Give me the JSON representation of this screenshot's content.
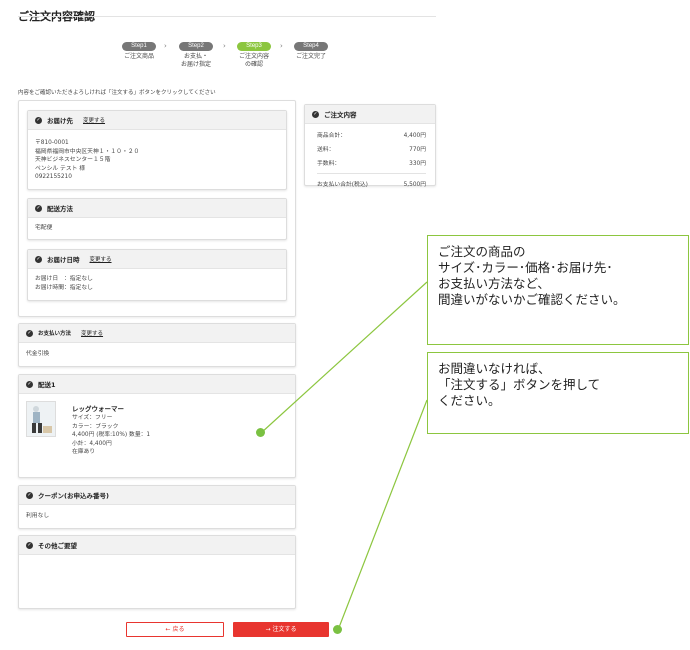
{
  "page": {
    "title": "ご注文内容確認",
    "intro": "内容をご確認いただきよろしければ「注文する」ボタンをクリックしてください"
  },
  "steps": [
    {
      "pill": "Step1",
      "label": "ご注文商品",
      "active": false
    },
    {
      "pill": "Step2",
      "label": "お支払・\nお届け指定",
      "active": false
    },
    {
      "pill": "Step3",
      "label": "ご注文内容\nの確認",
      "active": true
    },
    {
      "pill": "Step4",
      "label": "ご注文完了",
      "active": false
    }
  ],
  "delivery_address": {
    "heading": "お届け先",
    "change_link": "変更する",
    "lines": [
      "〒810-0001",
      "福岡県福岡市中央区天神１・１０・２０",
      "天神ビジネスセンター１５階",
      "ペンシル テスト 様",
      "0922155210"
    ]
  },
  "shipping_method": {
    "heading": "配送方法",
    "value": "宅配便"
  },
  "delivery_time": {
    "heading": "お届け日時",
    "change_link": "変更する",
    "lines": [
      "お届け日　：指定なし",
      "お届け時間：指定なし"
    ]
  },
  "payment": {
    "heading": "お支払い方法",
    "change_link": "変更する",
    "value": "代金引換"
  },
  "shipment": {
    "heading": "配送1",
    "item": {
      "name": "レッグウォーマー",
      "lines": [
        "サイズ：フリー",
        "カラー：ブラック",
        "4,400円 (税率:10%) 数量：1",
        "小計：4,400円",
        "在庫あり"
      ]
    }
  },
  "coupon": {
    "heading": "クーポン(お申込み番号)",
    "value": "利用なし"
  },
  "other_requests": {
    "heading": "その他ご要望"
  },
  "summary": {
    "heading": "ご注文内容",
    "rows": [
      {
        "label": "商品合計：",
        "value": "4,400円"
      },
      {
        "label": "送料：",
        "value": "770円"
      },
      {
        "label": "手数料：",
        "value": "330円"
      }
    ],
    "total_label": "お支払い合計(税込)",
    "total_value": "5,500円"
  },
  "buttons": {
    "back": "戻る",
    "submit": "注文する"
  },
  "callouts": {
    "first": [
      "ご注文の商品の",
      "サイズ･カラー･価格･お届け先･",
      "お支払い方法など、",
      "間違いがないかご確認ください。"
    ],
    "second": [
      "お間違いなければ、",
      "「注文する」ボタンを押して",
      "ください。"
    ]
  },
  "colors": {
    "accent_green": "#8cc63f",
    "submit_red": "#e8352f",
    "back_border": "#e8352f"
  },
  "icons": {
    "check": "check-circle-icon",
    "step_arrow": "chevron-right-icon",
    "back": "arrow-left-icon",
    "submit": "arrow-right-icon"
  }
}
